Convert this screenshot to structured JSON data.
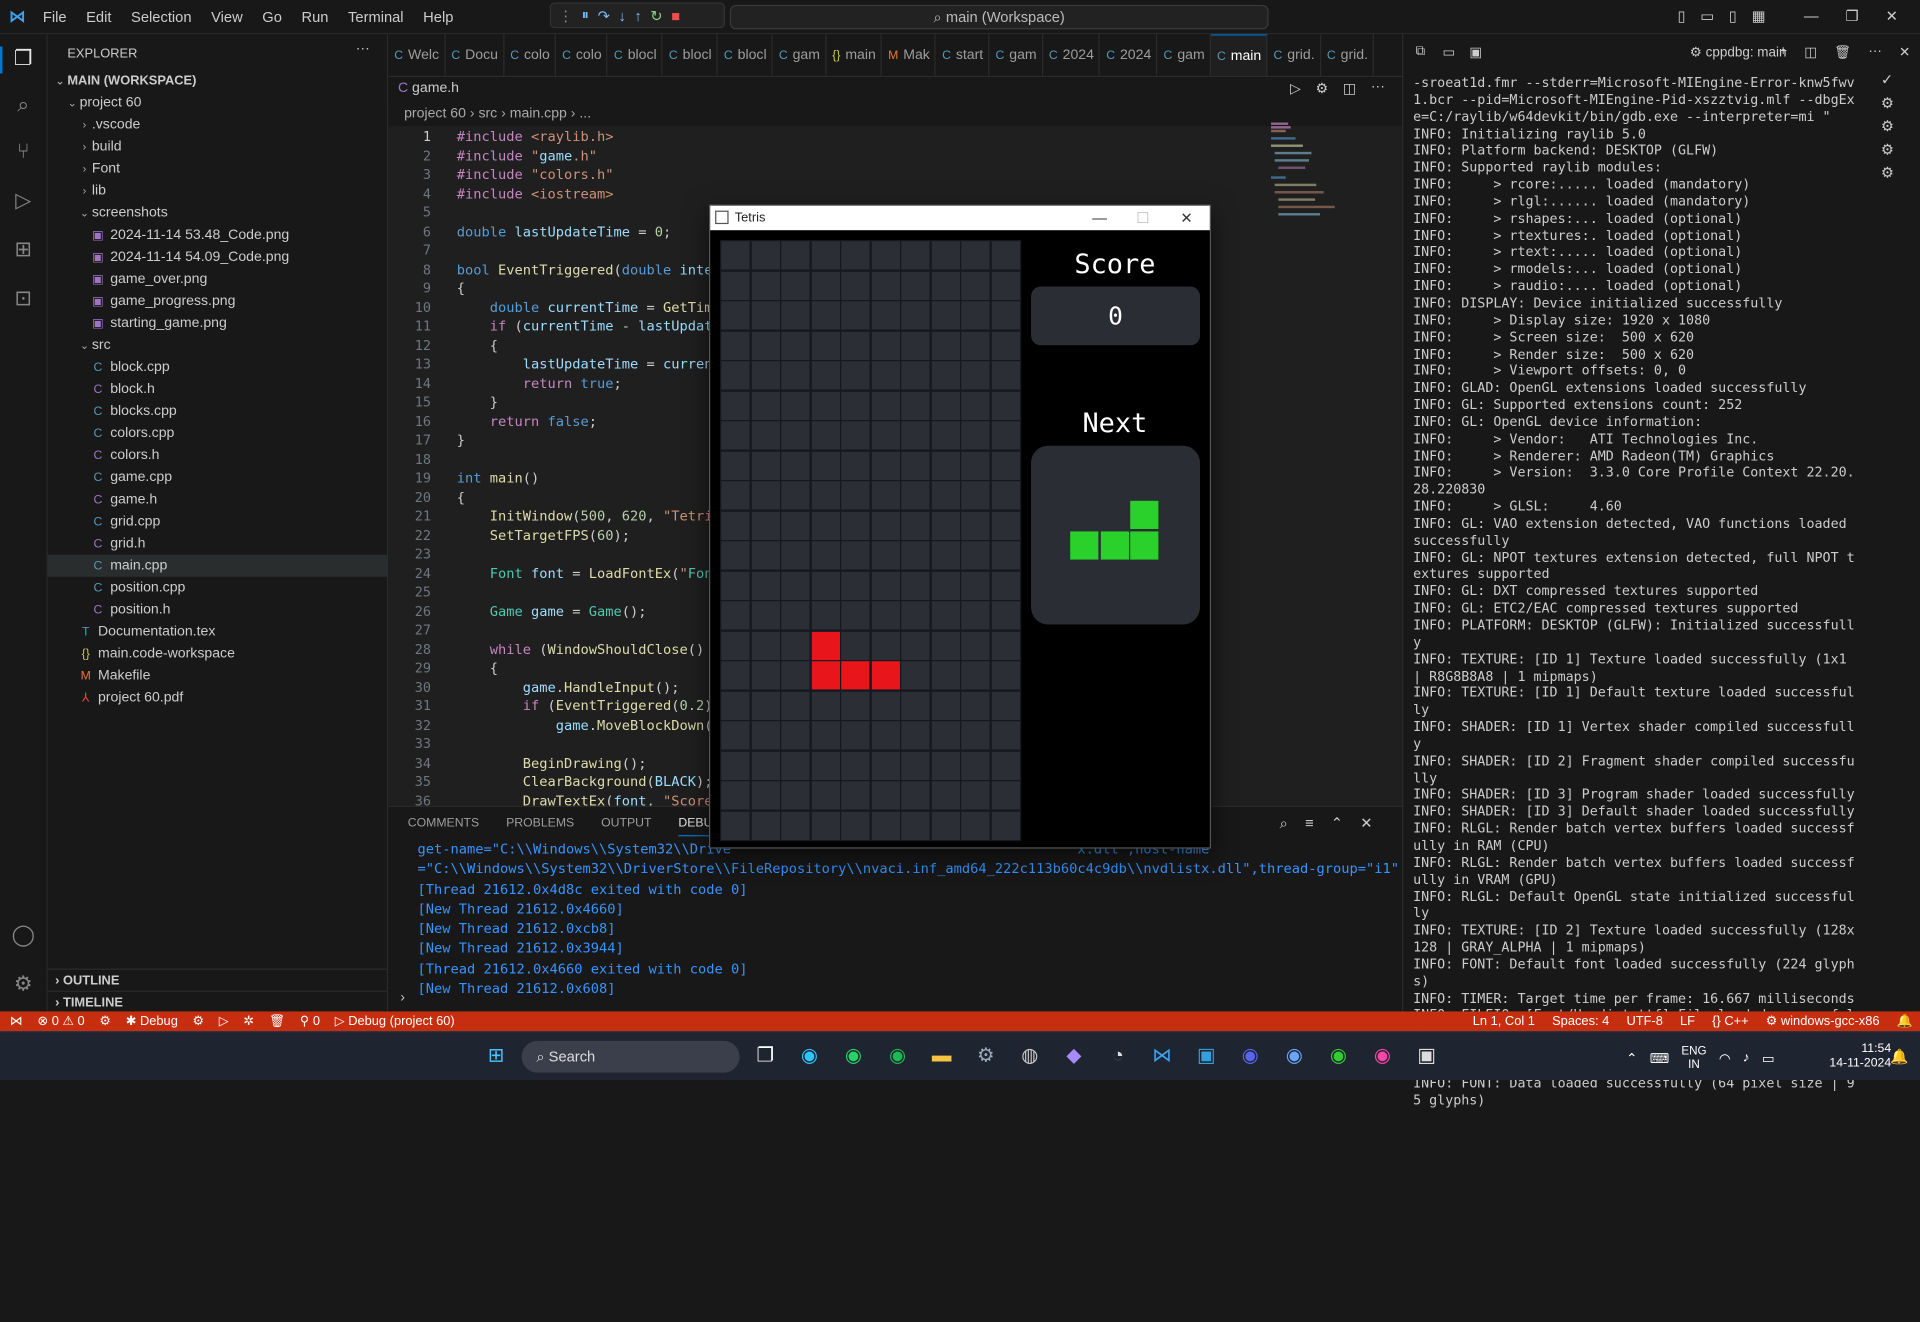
{
  "titlebar": {
    "menu": [
      "File",
      "Edit",
      "Selection",
      "View",
      "Go",
      "Run",
      "Terminal",
      "Help"
    ],
    "command_center": "main (Workspace)"
  },
  "explorer": {
    "title": "EXPLORER",
    "workspace": "MAIN (WORKSPACE)",
    "items": [
      {
        "label": "project 60",
        "depth": 1,
        "type": "open-folder"
      },
      {
        "label": ".vscode",
        "depth": 2,
        "type": "folder"
      },
      {
        "label": "build",
        "depth": 2,
        "type": "folder"
      },
      {
        "label": "Font",
        "depth": 2,
        "type": "folder"
      },
      {
        "label": "lib",
        "depth": 2,
        "type": "folder"
      },
      {
        "label": "screenshots",
        "depth": 2,
        "type": "open-folder"
      },
      {
        "label": "2024-11-14 53.48_Code.png",
        "depth": 3,
        "type": "png"
      },
      {
        "label": "2024-11-14 54.09_Code.png",
        "depth": 3,
        "type": "png"
      },
      {
        "label": "game_over.png",
        "depth": 3,
        "type": "png"
      },
      {
        "label": "game_progress.png",
        "depth": 3,
        "type": "png"
      },
      {
        "label": "starting_game.png",
        "depth": 3,
        "type": "png"
      },
      {
        "label": "src",
        "depth": 2,
        "type": "open-folder"
      },
      {
        "label": "block.cpp",
        "depth": 3,
        "type": "cpp"
      },
      {
        "label": "block.h",
        "depth": 3,
        "type": "h"
      },
      {
        "label": "blocks.cpp",
        "depth": 3,
        "type": "cpp"
      },
      {
        "label": "colors.cpp",
        "depth": 3,
        "type": "cpp"
      },
      {
        "label": "colors.h",
        "depth": 3,
        "type": "h"
      },
      {
        "label": "game.cpp",
        "depth": 3,
        "type": "cpp"
      },
      {
        "label": "game.h",
        "depth": 3,
        "type": "h"
      },
      {
        "label": "grid.cpp",
        "depth": 3,
        "type": "cpp"
      },
      {
        "label": "grid.h",
        "depth": 3,
        "type": "h"
      },
      {
        "label": "main.cpp",
        "depth": 3,
        "type": "cpp",
        "selected": true
      },
      {
        "label": "position.cpp",
        "depth": 3,
        "type": "cpp"
      },
      {
        "label": "position.h",
        "depth": 3,
        "type": "h"
      },
      {
        "label": "Documentation.tex",
        "depth": 2,
        "type": "tex"
      },
      {
        "label": "main.code-workspace",
        "depth": 2,
        "type": "json"
      },
      {
        "label": "Makefile",
        "depth": 2,
        "type": "mk"
      },
      {
        "label": "project 60.pdf",
        "depth": 2,
        "type": "pdf"
      }
    ],
    "outline": "OUTLINE",
    "timeline": "TIMELINE"
  },
  "tabs": [
    {
      "icon": "C",
      "label": "Welc"
    },
    {
      "icon": "C",
      "label": "Docu"
    },
    {
      "icon": "C",
      "label": "colo"
    },
    {
      "icon": "C",
      "label": "colo"
    },
    {
      "icon": "C",
      "label": "blocl"
    },
    {
      "icon": "C",
      "label": "blocl"
    },
    {
      "icon": "C",
      "label": "blocl"
    },
    {
      "icon": "C",
      "label": "gam"
    },
    {
      "icon": "{}",
      "label": "main"
    },
    {
      "icon": "M",
      "label": "Mak"
    },
    {
      "icon": "C",
      "label": "start"
    },
    {
      "icon": "C",
      "label": "gam"
    },
    {
      "icon": "C",
      "label": "2024"
    },
    {
      "icon": "C",
      "label": "2024"
    },
    {
      "icon": "C",
      "label": "gam"
    },
    {
      "icon": "C",
      "label": "main",
      "active": true
    },
    {
      "icon": "C",
      "label": "grid."
    },
    {
      "icon": "C",
      "label": "grid."
    }
  ],
  "secondary_tab": "game.h",
  "breadcrumb": "project 60 › src › main.cpp › ...",
  "code_lines": [
    "#include <raylib.h>",
    "#include \"game.h\"",
    "#include \"colors.h\"",
    "#include <iostream>",
    "",
    "double lastUpdateTime = 0;",
    "",
    "bool EventTriggered(double interv",
    "{",
    "    double currentTime = GetTime(",
    "    if (currentTime - lastUpdateT",
    "    {",
    "        lastUpdateTime = currentT",
    "        return true;",
    "    }",
    "    return false;",
    "}",
    "",
    "int main()",
    "{",
    "    InitWindow(500, 620, \"Tetris\"",
    "    SetTargetFPS(60);",
    "",
    "    Font font = LoadFontEx(\"Font/",
    "",
    "    Game game = Game();",
    "",
    "    while (WindowShouldClose() ==",
    "    {",
    "        game.HandleInput();",
    "        if (EventTriggered(0.2))",
    "            game.MoveBlockDown();",
    "",
    "        BeginDrawing();",
    "        ClearBackground(BLACK);",
    "        DrawTextEx(font, \"Score\","
  ],
  "panel": {
    "tabs": [
      "COMMENTS",
      "PROBLEMS",
      "OUTPUT",
      "DEBUG CONSO"
    ],
    "output": [
      "get-name=\"C:\\\\Windows\\\\System32\\\\Drive                                          x.dll\",host-name",
      "=\"C:\\\\Windows\\\\System32\\\\DriverStore\\\\FileRepository\\\\nvaci.inf_amd64_222c113b60c4c9db\\\\nvdlistx.dll\",thread-group=\"i1\"",
      "[Thread 21612.0x4d8c exited with code 0]",
      "[New Thread 21612.0x4660]",
      "[New Thread 21612.0xcb8]",
      "[New Thread 21612.0x3944]",
      "[Thread 21612.0x4660 exited with code 0]",
      "[New Thread 21612.0x608]"
    ]
  },
  "debug_console": {
    "config": "cppdbg: main",
    "log": "-sroeat1d.fmr --stderr=Microsoft-MIEngine-Error-knw5fwv1.bcr --pid=Microsoft-MIEngine-Pid-xszztvig.mlf --dbgExe=C:/raylib/w64devkit/bin/gdb.exe --interpreter=mi \"\nINFO: Initializing raylib 5.0\nINFO: Platform backend: DESKTOP (GLFW)\nINFO: Supported raylib modules:\nINFO:     > rcore:..... loaded (mandatory)\nINFO:     > rlgl:...... loaded (mandatory)\nINFO:     > rshapes:... loaded (optional)\nINFO:     > rtextures:. loaded (optional)\nINFO:     > rtext:..... loaded (optional)\nINFO:     > rmodels:... loaded (optional)\nINFO:     > raudio:.... loaded (optional)\nINFO: DISPLAY: Device initialized successfully\nINFO:     > Display size: 1920 x 1080\nINFO:     > Screen size:  500 x 620\nINFO:     > Render size:  500 x 620\nINFO:     > Viewport offsets: 0, 0\nINFO: GLAD: OpenGL extensions loaded successfully\nINFO: GL: Supported extensions count: 252\nINFO: GL: OpenGL device information:\nINFO:     > Vendor:   ATI Technologies Inc.\nINFO:     > Renderer: AMD Radeon(TM) Graphics\nINFO:     > Version:  3.3.0 Core Profile Context 22.20.28.220830\nINFO:     > GLSL:     4.60\nINFO: GL: VAO extension detected, VAO functions loaded successfully\nINFO: GL: NPOT textures extension detected, full NPOT textures supported\nINFO: GL: DXT compressed textures supported\nINFO: GL: ETC2/EAC compressed textures supported\nINFO: PLATFORM: DESKTOP (GLFW): Initialized successfully\nINFO: TEXTURE: [ID 1] Texture loaded successfully (1x1 | R8G8B8A8 | 1 mipmaps)\nINFO: TEXTURE: [ID 1] Default texture loaded successfully\nINFO: SHADER: [ID 1] Vertex shader compiled successfully\nINFO: SHADER: [ID 2] Fragment shader compiled successfully\nINFO: SHADER: [ID 3] Program shader loaded successfully\nINFO: SHADER: [ID 3] Default shader loaded successfully\nINFO: RLGL: Render batch vertex buffers loaded successfully in RAM (CPU)\nINFO: RLGL: Render batch vertex buffers loaded successfully in VRAM (GPU)\nINFO: RLGL: Default OpenGL state initialized successfully\nINFO: TEXTURE: [ID 2] Texture loaded successfully (128x128 | GRAY_ALPHA | 1 mipmaps)\nINFO: FONT: Default font loaded successfully (224 glyphs)\nINFO: TIMER: Target time per frame: 16.667 milliseconds\nINFO: FILEIO: [Font/Handjet.ttf] File loaded successfully\nINFO: TEXTURE: [ID 3] Texture loaded successfully (512x512 | GRAY_ALPHA | 1 mipmaps)\nINFO: FONT: Data loaded successfully (64 pixel size | 95 glyphs)"
  },
  "status": {
    "errors": "0",
    "warnings": "0",
    "debug": "Debug",
    "ports": "0",
    "launch": "Debug (project 60)",
    "position": "Ln 1, Col 1",
    "spaces": "Spaces: 4",
    "encoding": "UTF-8",
    "eol": "LF",
    "language": "{} C++",
    "config": "windows-gcc-x86"
  },
  "tetris": {
    "window_title": "Tetris",
    "score_label": "Score",
    "score": "0",
    "next_label": "Next",
    "grid_cols": 10,
    "grid_rows": 20,
    "block_color": "#e8161b",
    "next_color": "#2bd12b",
    "active_cells": [
      [
        13,
        3
      ],
      [
        14,
        3
      ],
      [
        14,
        4
      ],
      [
        14,
        5
      ]
    ],
    "next_cells": [
      [
        0,
        2
      ],
      [
        1,
        0
      ],
      [
        1,
        1
      ],
      [
        1,
        2
      ]
    ]
  },
  "taskbar": {
    "search": "Search",
    "lang": "ENG",
    "region": "IN",
    "time": "11:54",
    "date": "14-11-2024"
  }
}
